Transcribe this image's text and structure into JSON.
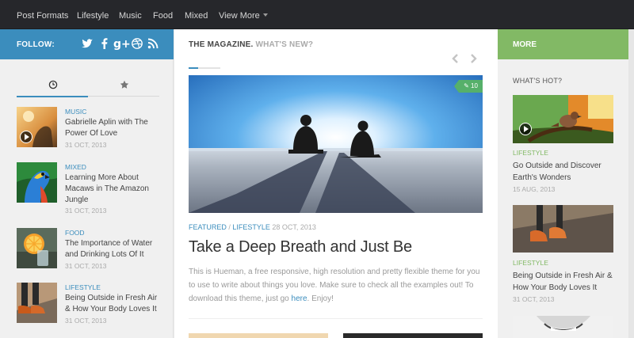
{
  "nav": {
    "items": [
      "Post Formats",
      "Lifestyle",
      "Music",
      "Food",
      "Mixed",
      "View More"
    ]
  },
  "left": {
    "follow_label": "FOLLOW:",
    "social_icons": [
      "twitter-icon",
      "facebook-icon",
      "google-plus-icon",
      "dribbble-icon",
      "rss-icon"
    ],
    "tabs": [
      "clock-icon",
      "star-icon"
    ],
    "posts": [
      {
        "category": "MUSIC",
        "title": "Gabrielle Aplin with The Power Of Love",
        "date": "31 OCT, 2013"
      },
      {
        "category": "MIXED",
        "title": "Learning More About Macaws in The Amazon Jungle",
        "date": "31 OCT, 2013"
      },
      {
        "category": "FOOD",
        "title": "The Importance of Water and Drinking Lots Of It",
        "date": "31 OCT, 2013"
      },
      {
        "category": "LIFESTYLE",
        "title": "Being Outside in Fresh Air & How Your Body Loves It",
        "date": "31 OCT, 2013"
      }
    ]
  },
  "center": {
    "heading": "THE MAGAZINE.",
    "heading_sub": "WHAT'S NEW?",
    "comment_count": "10",
    "meta_cat1": "FEATURED",
    "meta_sep": " / ",
    "meta_cat2": "LIFESTYLE",
    "meta_date": "28 OCT, 2013",
    "title": "Take a Deep Breath and Just Be",
    "excerpt_before": "This is Hueman, a free responsive, high resolution and pretty flexible theme for you to use to write about things you love. Make sure to check all the examples out! To download this theme, just go ",
    "excerpt_link": "here",
    "excerpt_after": ". Enjoy!"
  },
  "right": {
    "more_label": "MORE",
    "whats_hot": "WHAT'S HOT?",
    "posts": [
      {
        "category": "LIFESTYLE",
        "title": "Go Outside and Discover Earth's Wonders",
        "date": "15 AUG, 2013"
      },
      {
        "category": "LIFESTYLE",
        "title": "Being Outside in Fresh Air & How Your Body Loves It",
        "date": "31 OCT, 2013"
      }
    ]
  },
  "colors": {
    "accent_blue": "#3b8dbd",
    "accent_green": "#82b965",
    "nav_bg": "#26272b"
  }
}
